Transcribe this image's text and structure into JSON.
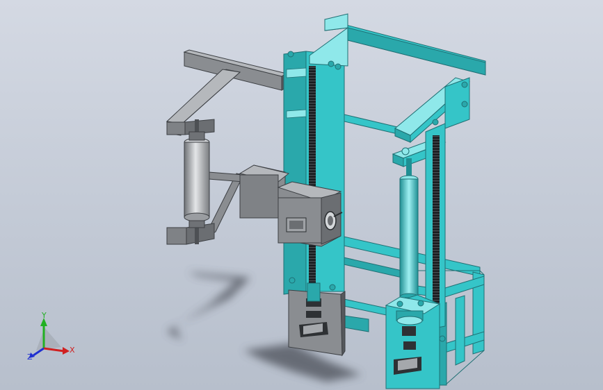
{
  "view": {
    "background_top": "#d4d9e3",
    "background_bottom": "#b7bfcc",
    "colors": {
      "frame_cyan": "#35c5c8",
      "frame_cyan_dark": "#1f8f93",
      "frame_cyan_light": "#8fe8ea",
      "part_gray": "#8a8d91",
      "part_gray_dark": "#55585c",
      "part_gray_light": "#b5b8bc",
      "screw_black": "#1a1d20",
      "shadow": "#4c5058"
    }
  },
  "triad": {
    "x_label": "X",
    "y_label": "Y",
    "z_label": "Z",
    "x_color": "#d02020",
    "y_color": "#22b022",
    "z_color": "#2030d0"
  }
}
